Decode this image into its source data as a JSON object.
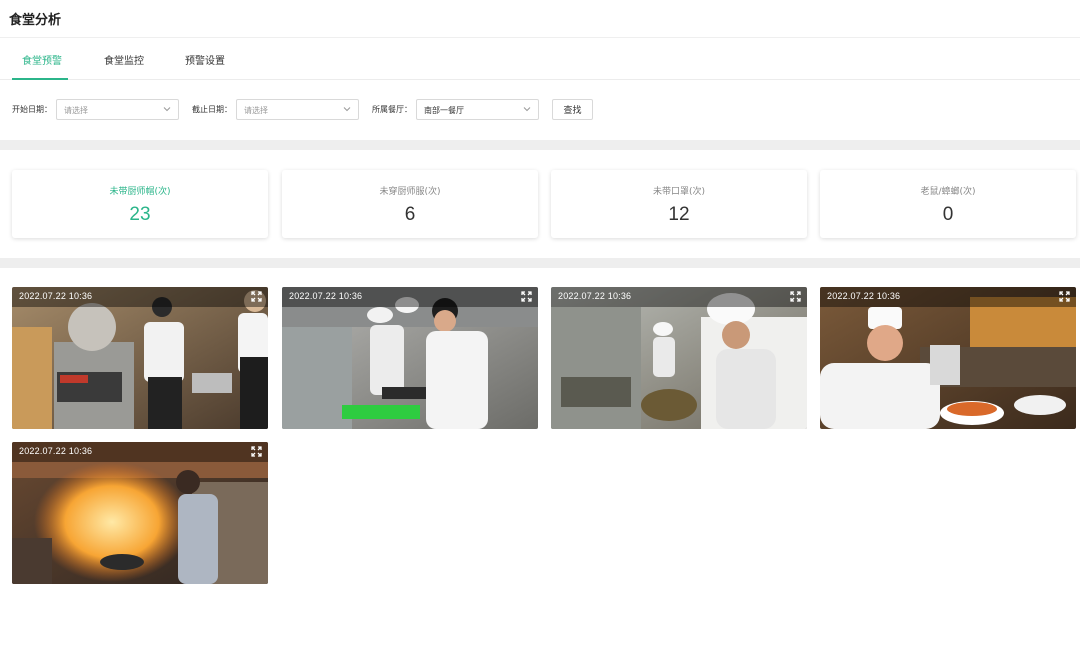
{
  "page": {
    "title": "食堂分析"
  },
  "tabs": [
    {
      "label": "食堂预警",
      "active": true
    },
    {
      "label": "食堂监控",
      "active": false
    },
    {
      "label": "预警设置",
      "active": false
    }
  ],
  "filters": {
    "start_label": "开始日期：",
    "start_placeholder": "请选择",
    "end_label": "截止日期：",
    "end_placeholder": "请选择",
    "canteen_label": "所属餐厅：",
    "canteen_value": "南部一餐厅",
    "search_label": "查找"
  },
  "stats": [
    {
      "label": "未带厨师帽(次)",
      "value": "23",
      "active": true
    },
    {
      "label": "未穿厨师服(次)",
      "value": "6",
      "active": false
    },
    {
      "label": "未带口罩(次)",
      "value": "12",
      "active": false
    },
    {
      "label": "老鼠/蟑螂(次)",
      "value": "0",
      "active": false
    }
  ],
  "photos": [
    {
      "timestamp": "2022.07.22  10:36",
      "scene": "kitchen-staff-dishwashing"
    },
    {
      "timestamp": "2022.07.22  10:36",
      "scene": "chefs-preparing-food"
    },
    {
      "timestamp": "2022.07.22  10:36",
      "scene": "chef-at-counter"
    },
    {
      "timestamp": "2022.07.22  10:36",
      "scene": "chef-with-noodles"
    },
    {
      "timestamp": "2022.07.22  10:36",
      "scene": "wok-fire-cooking"
    }
  ],
  "colors": {
    "accent": "#2bb58a",
    "band": "#eeeeee"
  },
  "icons": {
    "select_arrow": "chevron-down-icon",
    "photo_action": "expand-icon"
  }
}
